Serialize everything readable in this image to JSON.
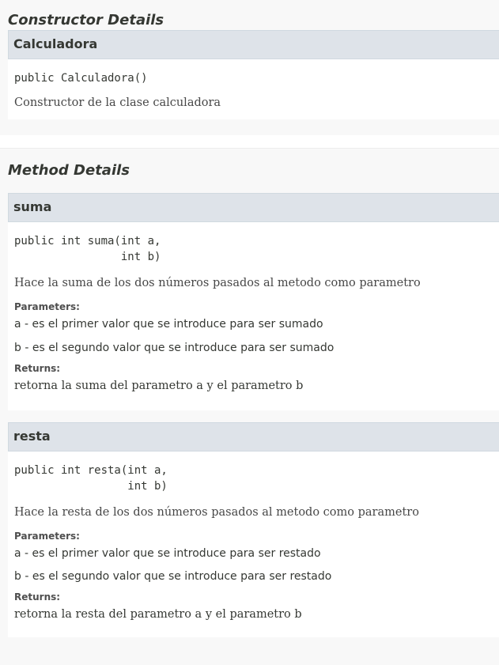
{
  "constructor_section": {
    "title": "Constructor Details",
    "item": {
      "name": "Calculadora",
      "signature": "public Calculadora()",
      "description": "Constructor de la clase calculadora"
    }
  },
  "method_section": {
    "title": "Method Details",
    "methods": [
      {
        "name": "suma",
        "signature": "public int suma(int a,\n                int b)",
        "description": "Hace la suma de los dos números pasados al metodo como parametro",
        "params_label": "Parameters:",
        "param_a": "a - es el primer valor que se introduce para ser sumado",
        "param_b": "b - es el segundo valor que se introduce para ser sumado",
        "returns_label": "Returns:",
        "returns": "retorna la suma del parametro a y el parametro b"
      },
      {
        "name": "resta",
        "signature": "public int resta(int a,\n                 int b)",
        "description": "Hace la resta de los dos números pasados al metodo como parametro",
        "params_label": "Parameters:",
        "param_a": "a - es el primer valor que se introduce para ser restado",
        "param_b": "b - es el segundo valor que se introduce para ser restado",
        "returns_label": "Returns:",
        "returns": "retorna la resta del parametro a y el parametro b"
      }
    ]
  }
}
